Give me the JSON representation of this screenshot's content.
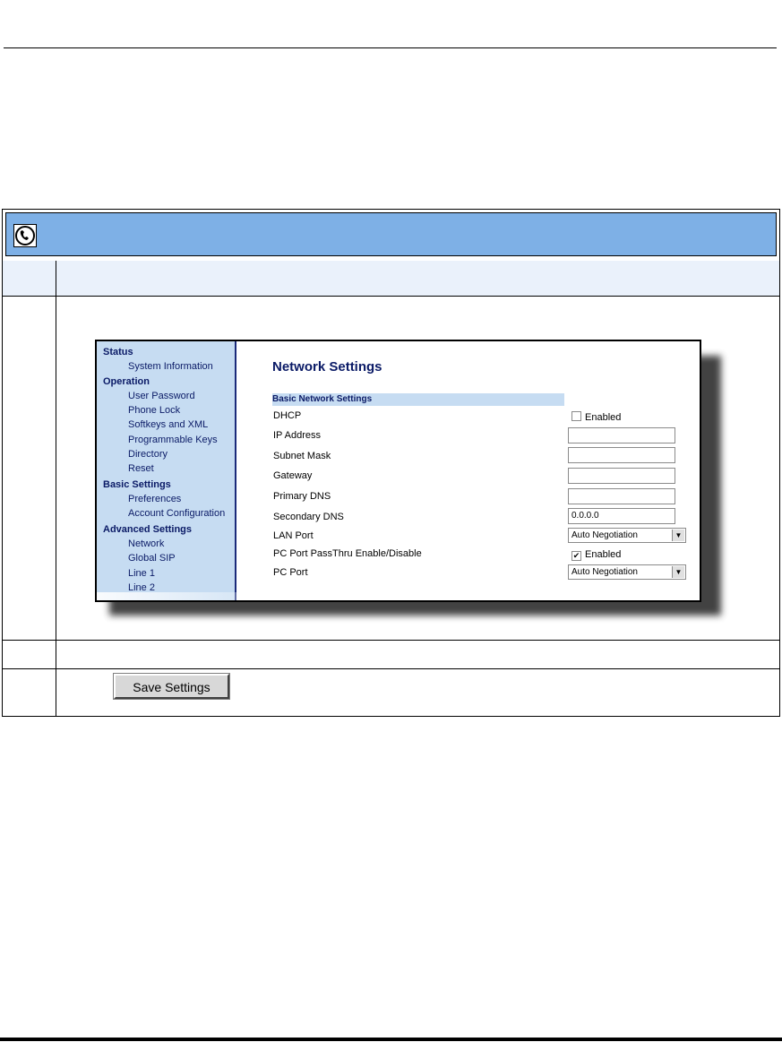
{
  "nav": {
    "sections": [
      {
        "title": "Status",
        "items": [
          "System Information"
        ]
      },
      {
        "title": "Operation",
        "items": [
          "User Password",
          "Phone Lock",
          "Softkeys and XML",
          "Programmable Keys",
          "Directory",
          "Reset"
        ]
      },
      {
        "title": "Basic Settings",
        "items": [
          "Preferences",
          "Account Configuration"
        ]
      },
      {
        "title": "Advanced Settings",
        "items": [
          "Network",
          "Global SIP",
          "Line 1",
          "Line 2"
        ]
      }
    ]
  },
  "network": {
    "title": "Network Settings",
    "section": "Basic Network Settings",
    "dhcp_label": "DHCP",
    "dhcp_check": "Enabled",
    "ip_label": "IP Address",
    "ip_value": "",
    "subnet_label": "Subnet Mask",
    "subnet_value": "",
    "gateway_label": "Gateway",
    "gateway_value": "",
    "pdns_label": "Primary DNS",
    "pdns_value": "",
    "sdns_label": "Secondary DNS",
    "sdns_value": "0.0.0.0",
    "lan_label": "LAN Port",
    "lan_value": "Auto Negotiation",
    "passthru_label": "PC Port PassThru Enable/Disable",
    "passthru_check": "Enabled",
    "pc_label": "PC Port",
    "pc_value": "Auto Negotiation"
  },
  "save_label": "Save Settings",
  "check_mark": "✔"
}
